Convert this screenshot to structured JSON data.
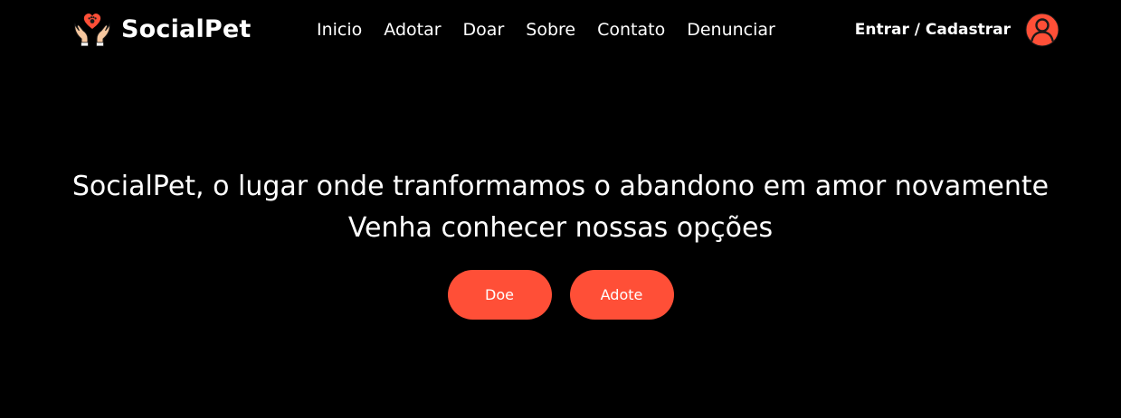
{
  "colors": {
    "background": "#000000",
    "text": "#ffffff",
    "accent": "#ff4f37"
  },
  "header": {
    "brand_name": "SocialPet",
    "brand_icon": "hands-heart-paw-icon",
    "nav": [
      {
        "label": "Inicio"
      },
      {
        "label": "Adotar"
      },
      {
        "label": "Doar"
      },
      {
        "label": "Sobre"
      },
      {
        "label": "Contato"
      },
      {
        "label": "Denunciar"
      }
    ],
    "auth_label": "Entrar / Cadastrar",
    "avatar_icon": "user-avatar-icon"
  },
  "hero": {
    "headline": "SocialPet, o lugar onde tranformamos o abandono em amor novamente",
    "subheadline": "Venha conhecer nossas opções",
    "buttons": [
      {
        "label": "Doe"
      },
      {
        "label": "Adote"
      }
    ]
  }
}
